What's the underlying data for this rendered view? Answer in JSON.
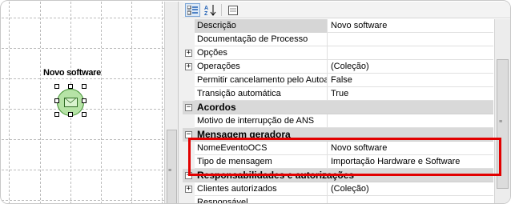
{
  "diagram": {
    "node_title": "Novo software",
    "node_icon": "envelope-icon",
    "node_fill": "#b6e3a6"
  },
  "toolbar": {
    "categorized_icon": "categorized-view-icon",
    "alphabetical_icon": "sort-az-icon",
    "alphabetical_label": "AZ",
    "pages_icon": "property-pages-icon"
  },
  "properties": [
    {
      "kind": "prop",
      "name": "Descrição",
      "value": "Novo software",
      "selected": true
    },
    {
      "kind": "prop",
      "name": "Documentação de Processo",
      "value": ""
    },
    {
      "kind": "prop",
      "name": "Opções",
      "value": "",
      "expander": "+"
    },
    {
      "kind": "prop",
      "name": "Operações",
      "value": "(Coleção)",
      "expander": "+"
    },
    {
      "kind": "prop",
      "name": "Permitir cancelamento pelo Autoat",
      "value": "False"
    },
    {
      "kind": "prop",
      "name": "Transição automática",
      "value": "True"
    },
    {
      "kind": "cat",
      "name": "Acordos",
      "expander": "−"
    },
    {
      "kind": "prop",
      "name": "Motivo de interrupção de ANS",
      "value": ""
    },
    {
      "kind": "cat",
      "name": "Mensagem geradora",
      "expander": "−"
    },
    {
      "kind": "prop",
      "name": "NomeEventoOCS",
      "value": "Novo software"
    },
    {
      "kind": "prop",
      "name": "Tipo de mensagem",
      "value": "Importação Hardware e Software"
    },
    {
      "kind": "cat",
      "name": "Responsabilidades e autorizações",
      "expander": "−"
    },
    {
      "kind": "prop",
      "name": "Clientes autorizados",
      "value": "(Coleção)",
      "expander": "+"
    },
    {
      "kind": "prop",
      "name": "Responsável",
      "value": ""
    }
  ],
  "colors": {
    "highlight": "#e20000",
    "category_bg": "#d9d9d9"
  }
}
